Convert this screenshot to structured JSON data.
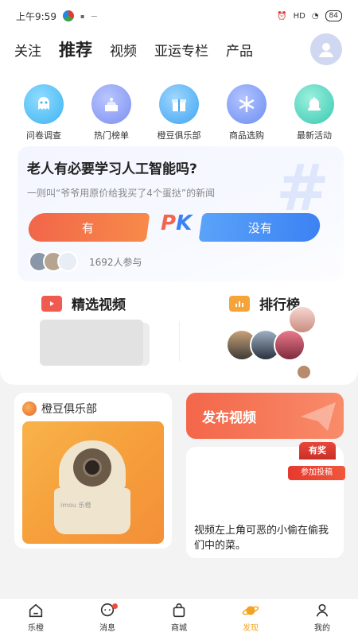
{
  "status": {
    "time": "上午9:59",
    "battery": "84",
    "network": "HD"
  },
  "top_tabs": [
    "关注",
    "推荐",
    "视频",
    "亚运专栏",
    "产品"
  ],
  "active_tab": 1,
  "quick_items": [
    {
      "label": "问卷调查",
      "icon": "ghost-icon",
      "color": "#3fb3f2"
    },
    {
      "label": "热门榜单",
      "icon": "cake-icon",
      "color": "#7c8ff0"
    },
    {
      "label": "橙豆俱乐部",
      "icon": "gift-icon",
      "color": "#3fa5f0"
    },
    {
      "label": "商品选购",
      "icon": "snowflake-icon",
      "color": "#6b8ef2"
    },
    {
      "label": "最新活动",
      "icon": "bell-icon",
      "color": "#38c9b0"
    }
  ],
  "pk": {
    "question": "老人有必要学习人工智能吗?",
    "subtitle": "一则叫“爷爷用原价给我买了4个蛋挞”的新闻",
    "yes_label": "有",
    "no_label": "没有",
    "vs_p": "P",
    "vs_k": "K",
    "participants": "1692人参与"
  },
  "sections": {
    "videos": "精选视频",
    "ranking": "排行榜"
  },
  "club": {
    "title": "橙豆俱乐部",
    "brand": "imou 乐橙"
  },
  "publish": {
    "label": "发布视频"
  },
  "prize": {
    "badge": "有奖",
    "button": "参加投稿",
    "caption": "视频左上角可恶的小偷在偷我们中的菜。"
  },
  "bottom_nav": [
    {
      "label": "乐橙",
      "icon": "home-icon"
    },
    {
      "label": "消息",
      "icon": "message-icon"
    },
    {
      "label": "商城",
      "icon": "shopping-bag-icon"
    },
    {
      "label": "发现",
      "icon": "planet-icon"
    },
    {
      "label": "我的",
      "icon": "person-icon"
    }
  ],
  "bottom_active": 3,
  "colors": {
    "accent": "#f3a31f",
    "yes": "#f2664a",
    "no": "#3c82f3"
  }
}
